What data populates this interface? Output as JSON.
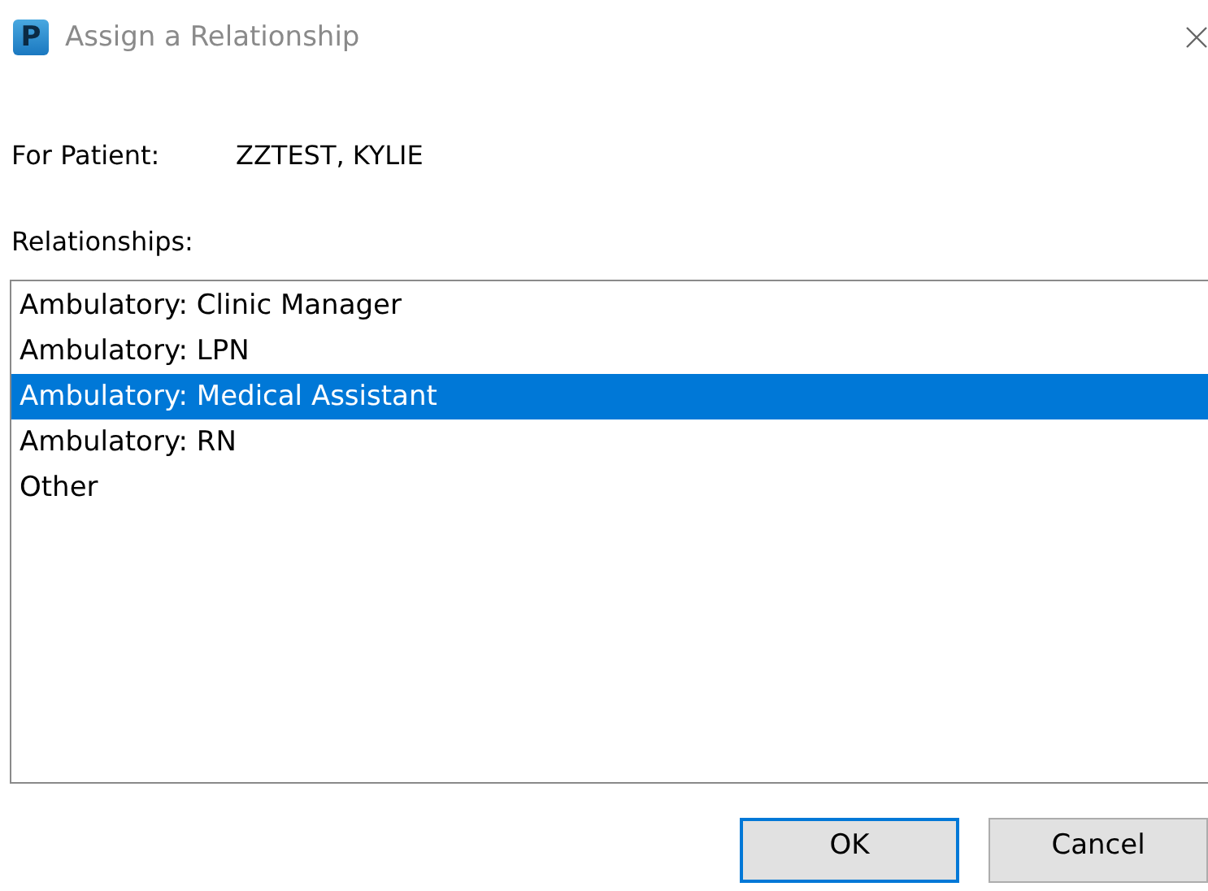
{
  "window": {
    "title": "Assign a Relationship",
    "app_icon_letter": "P"
  },
  "patient": {
    "label": "For Patient:",
    "value": "ZZTEST, KYLIE"
  },
  "relationships": {
    "label": "Relationships:",
    "items": [
      {
        "label": "Ambulatory: Clinic Manager",
        "selected": false
      },
      {
        "label": "Ambulatory: LPN",
        "selected": false
      },
      {
        "label": "Ambulatory: Medical Assistant",
        "selected": true
      },
      {
        "label": "Ambulatory: RN",
        "selected": false
      },
      {
        "label": "Other",
        "selected": false
      }
    ]
  },
  "buttons": [
    {
      "label": "OK",
      "default": true
    },
    {
      "label": "Cancel",
      "default": false
    }
  ]
}
